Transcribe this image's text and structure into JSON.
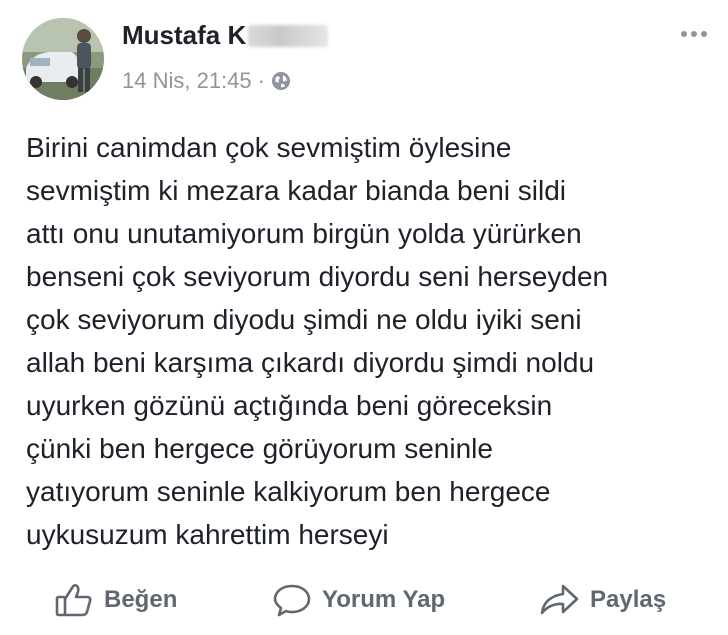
{
  "post": {
    "author": "Mustafa K",
    "timestamp": "14 Nis, 21:45",
    "separator": "·",
    "privacy_icon": "globe-icon",
    "menu_icon": "more-options-icon",
    "text": "Birini canimdan çok sevmiştim öylesine\nsevmiştim ki mezara kadar bianda beni sildi\nattı onu unutamiyorum birgün yolda yürürken\nbenseni çok seviyorum diyordu seni herseyden\nçok seviyorum diyodu şimdi ne oldu iyiki seni\nallah beni karşıma çıkardı diyordu şimdi noldu\nuyurken gözünü açtığında beni göreceksin\nçünki ben hergece görüyorum seninle\nyatıyorum seninle kalkiyorum ben hergece\nuykusuzum kahrettim herseyi"
  },
  "actions": {
    "like": {
      "label": "Beğen",
      "icon": "thumbs-up-icon"
    },
    "comment": {
      "label": "Yorum Yap",
      "icon": "comment-icon"
    },
    "share": {
      "label": "Paylaş",
      "icon": "share-arrow-icon"
    }
  },
  "colors": {
    "text": "#1d2129",
    "meta": "#90949c",
    "action": "#606770"
  }
}
